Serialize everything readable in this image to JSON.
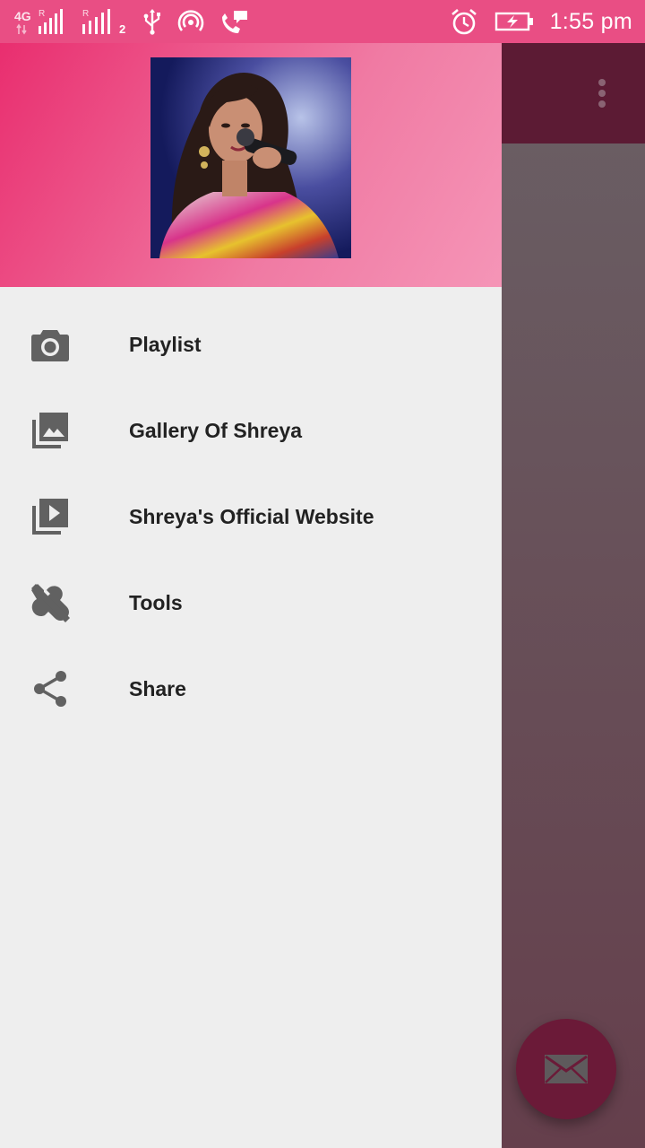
{
  "status_bar": {
    "network_type": "4G",
    "roaming_1": "R",
    "roaming_2": "R",
    "sim_number": "2",
    "time": "1:55 pm",
    "icons": [
      "signal-icon",
      "usb-icon",
      "hotspot-icon",
      "wifi-calling-icon",
      "alarm-icon",
      "battery-charging-icon"
    ]
  },
  "app": {
    "overflow_icon": "more-vert-icon",
    "fab_icon": "mail-icon"
  },
  "drawer": {
    "header_photo_icon": "profile-photo",
    "items": [
      {
        "label": "Playlist",
        "icon": "camera-icon"
      },
      {
        "label": "Gallery Of Shreya",
        "icon": "photo-library-icon"
      },
      {
        "label": "Shreya's Official Website",
        "icon": "video-library-icon"
      },
      {
        "label": "Tools",
        "icon": "wrench-icon"
      },
      {
        "label": "Share",
        "icon": "share-icon"
      }
    ]
  },
  "colors": {
    "status_bar": "#e94e84",
    "header_start": "#e92e6f",
    "header_end": "#f595b7",
    "toolbar": "#5c1b34",
    "fab": "#6b1a38",
    "drawer_bg": "#eeeeee",
    "icon_gray": "#616161"
  }
}
